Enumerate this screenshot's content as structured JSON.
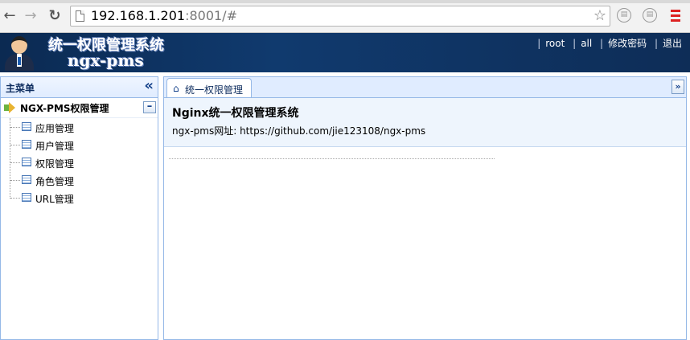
{
  "browser": {
    "url_host": "192.168.1.201",
    "url_rest": ":8001/#",
    "back_icon": "back-arrow-icon",
    "forward_icon": "forward-arrow-icon",
    "reload_icon": "reload-icon"
  },
  "header": {
    "title_cn": "统一权限管理系统",
    "title_en": "ngx-pms",
    "nav": [
      "root",
      "all",
      "修改密码",
      "退出"
    ]
  },
  "sidebar": {
    "title": "主菜单",
    "group": "NGX-PMS权限管理",
    "items": [
      "应用管理",
      "用户管理",
      "权限管理",
      "角色管理",
      "URL管理"
    ]
  },
  "main": {
    "tab_label": "统一权限管理",
    "heading": "Nginx统一权限管理系统",
    "desc": "ngx-pms网址: https://github.com/jie123108/ngx-pms"
  }
}
